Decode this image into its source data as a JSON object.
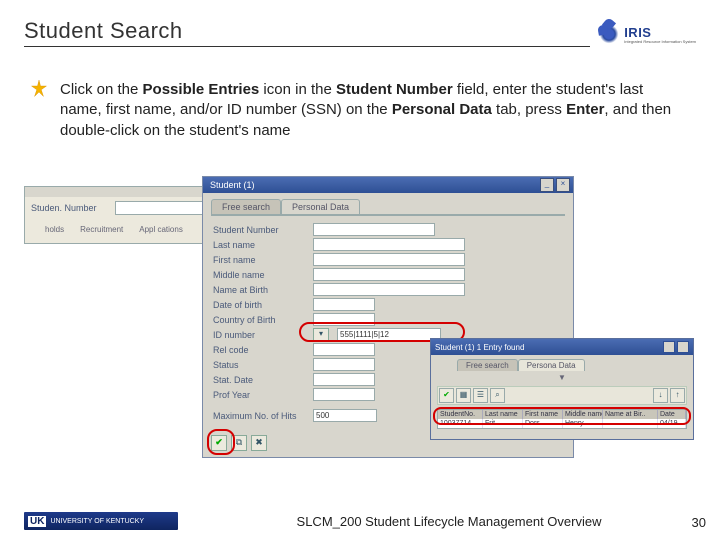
{
  "title": "Student Search",
  "logo": {
    "text": "IRIS",
    "sub": "Integrated Resource\nInformation System"
  },
  "bullet": {
    "pre": "Click on the ",
    "b1": "Possible Entries",
    "mid1": " icon in the ",
    "b2": "Student Number",
    "mid2": " field, enter the student's last name, first name, and/or ID number (SSN) on the ",
    "b3": "Personal Data",
    "mid3": " tab, press ",
    "b4": "Enter",
    "mid4": ", and then double-click on the student's name"
  },
  "left_frag": {
    "label": "Studen. Number",
    "tabs": [
      "holds",
      "Recruitment",
      "Appl cations"
    ]
  },
  "panel": {
    "tabs": [
      "Free search",
      "Personal Data"
    ],
    "fields": {
      "student_number": "Student Number",
      "last_name": "Last name",
      "first_name": "First name",
      "middle_name": "Middle name",
      "name_at_birth": "Name at Birth",
      "date_of_birth": "Date of birth",
      "country_birth": "Country of Birth",
      "id_number": "ID number",
      "id_value": "555|1111|5|12",
      "rel_code": "Rel code",
      "status": "Status",
      "stat_date": "Stat. Date",
      "prof_year": "Prof Year",
      "max_hits": "Maximum No. of Hits",
      "max_hits_value": "500"
    }
  },
  "results": {
    "title": "Student (1)   1 Entry found",
    "tabs": [
      "Free search",
      "Persona Data"
    ],
    "columns": [
      "StudentNo.",
      "Last name",
      "First name",
      "Middle name",
      "Name at Bir..",
      "Date"
    ],
    "row": {
      "studentno": "10037714",
      "last": "Frit",
      "first": "Dors",
      "middle": "Henry",
      "nab": "",
      "date": "04/19"
    }
  },
  "footer": {
    "uk": "UK",
    "uk_text": "UNIVERSITY OF KENTUCKY",
    "title": "SLCM_200 Student Lifecycle Management Overview",
    "slide": "30"
  }
}
